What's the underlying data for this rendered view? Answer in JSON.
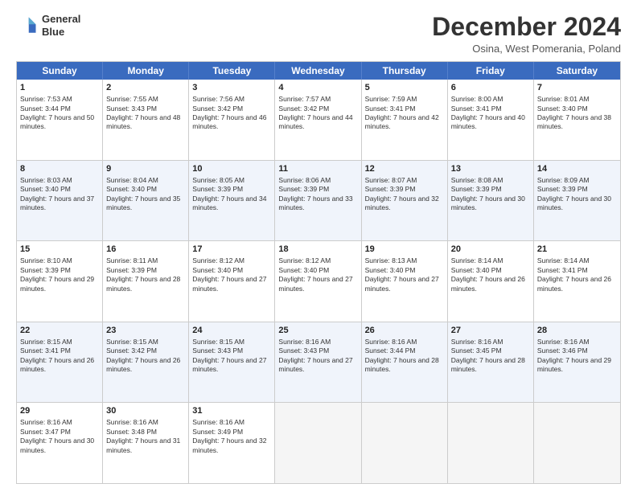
{
  "header": {
    "logo_line1": "General",
    "logo_line2": "Blue",
    "title": "December 2024",
    "subtitle": "Osina, West Pomerania, Poland"
  },
  "weekdays": [
    "Sunday",
    "Monday",
    "Tuesday",
    "Wednesday",
    "Thursday",
    "Friday",
    "Saturday"
  ],
  "rows": [
    [
      {
        "day": "1",
        "sunrise": "Sunrise: 7:53 AM",
        "sunset": "Sunset: 3:44 PM",
        "daylight": "Daylight: 7 hours and 50 minutes."
      },
      {
        "day": "2",
        "sunrise": "Sunrise: 7:55 AM",
        "sunset": "Sunset: 3:43 PM",
        "daylight": "Daylight: 7 hours and 48 minutes."
      },
      {
        "day": "3",
        "sunrise": "Sunrise: 7:56 AM",
        "sunset": "Sunset: 3:42 PM",
        "daylight": "Daylight: 7 hours and 46 minutes."
      },
      {
        "day": "4",
        "sunrise": "Sunrise: 7:57 AM",
        "sunset": "Sunset: 3:42 PM",
        "daylight": "Daylight: 7 hours and 44 minutes."
      },
      {
        "day": "5",
        "sunrise": "Sunrise: 7:59 AM",
        "sunset": "Sunset: 3:41 PM",
        "daylight": "Daylight: 7 hours and 42 minutes."
      },
      {
        "day": "6",
        "sunrise": "Sunrise: 8:00 AM",
        "sunset": "Sunset: 3:41 PM",
        "daylight": "Daylight: 7 hours and 40 minutes."
      },
      {
        "day": "7",
        "sunrise": "Sunrise: 8:01 AM",
        "sunset": "Sunset: 3:40 PM",
        "daylight": "Daylight: 7 hours and 38 minutes."
      }
    ],
    [
      {
        "day": "8",
        "sunrise": "Sunrise: 8:03 AM",
        "sunset": "Sunset: 3:40 PM",
        "daylight": "Daylight: 7 hours and 37 minutes."
      },
      {
        "day": "9",
        "sunrise": "Sunrise: 8:04 AM",
        "sunset": "Sunset: 3:40 PM",
        "daylight": "Daylight: 7 hours and 35 minutes."
      },
      {
        "day": "10",
        "sunrise": "Sunrise: 8:05 AM",
        "sunset": "Sunset: 3:39 PM",
        "daylight": "Daylight: 7 hours and 34 minutes."
      },
      {
        "day": "11",
        "sunrise": "Sunrise: 8:06 AM",
        "sunset": "Sunset: 3:39 PM",
        "daylight": "Daylight: 7 hours and 33 minutes."
      },
      {
        "day": "12",
        "sunrise": "Sunrise: 8:07 AM",
        "sunset": "Sunset: 3:39 PM",
        "daylight": "Daylight: 7 hours and 32 minutes."
      },
      {
        "day": "13",
        "sunrise": "Sunrise: 8:08 AM",
        "sunset": "Sunset: 3:39 PM",
        "daylight": "Daylight: 7 hours and 30 minutes."
      },
      {
        "day": "14",
        "sunrise": "Sunrise: 8:09 AM",
        "sunset": "Sunset: 3:39 PM",
        "daylight": "Daylight: 7 hours and 30 minutes."
      }
    ],
    [
      {
        "day": "15",
        "sunrise": "Sunrise: 8:10 AM",
        "sunset": "Sunset: 3:39 PM",
        "daylight": "Daylight: 7 hours and 29 minutes."
      },
      {
        "day": "16",
        "sunrise": "Sunrise: 8:11 AM",
        "sunset": "Sunset: 3:39 PM",
        "daylight": "Daylight: 7 hours and 28 minutes."
      },
      {
        "day": "17",
        "sunrise": "Sunrise: 8:12 AM",
        "sunset": "Sunset: 3:40 PM",
        "daylight": "Daylight: 7 hours and 27 minutes."
      },
      {
        "day": "18",
        "sunrise": "Sunrise: 8:12 AM",
        "sunset": "Sunset: 3:40 PM",
        "daylight": "Daylight: 7 hours and 27 minutes."
      },
      {
        "day": "19",
        "sunrise": "Sunrise: 8:13 AM",
        "sunset": "Sunset: 3:40 PM",
        "daylight": "Daylight: 7 hours and 27 minutes."
      },
      {
        "day": "20",
        "sunrise": "Sunrise: 8:14 AM",
        "sunset": "Sunset: 3:40 PM",
        "daylight": "Daylight: 7 hours and 26 minutes."
      },
      {
        "day": "21",
        "sunrise": "Sunrise: 8:14 AM",
        "sunset": "Sunset: 3:41 PM",
        "daylight": "Daylight: 7 hours and 26 minutes."
      }
    ],
    [
      {
        "day": "22",
        "sunrise": "Sunrise: 8:15 AM",
        "sunset": "Sunset: 3:41 PM",
        "daylight": "Daylight: 7 hours and 26 minutes."
      },
      {
        "day": "23",
        "sunrise": "Sunrise: 8:15 AM",
        "sunset": "Sunset: 3:42 PM",
        "daylight": "Daylight: 7 hours and 26 minutes."
      },
      {
        "day": "24",
        "sunrise": "Sunrise: 8:15 AM",
        "sunset": "Sunset: 3:43 PM",
        "daylight": "Daylight: 7 hours and 27 minutes."
      },
      {
        "day": "25",
        "sunrise": "Sunrise: 8:16 AM",
        "sunset": "Sunset: 3:43 PM",
        "daylight": "Daylight: 7 hours and 27 minutes."
      },
      {
        "day": "26",
        "sunrise": "Sunrise: 8:16 AM",
        "sunset": "Sunset: 3:44 PM",
        "daylight": "Daylight: 7 hours and 28 minutes."
      },
      {
        "day": "27",
        "sunrise": "Sunrise: 8:16 AM",
        "sunset": "Sunset: 3:45 PM",
        "daylight": "Daylight: 7 hours and 28 minutes."
      },
      {
        "day": "28",
        "sunrise": "Sunrise: 8:16 AM",
        "sunset": "Sunset: 3:46 PM",
        "daylight": "Daylight: 7 hours and 29 minutes."
      }
    ],
    [
      {
        "day": "29",
        "sunrise": "Sunrise: 8:16 AM",
        "sunset": "Sunset: 3:47 PM",
        "daylight": "Daylight: 7 hours and 30 minutes."
      },
      {
        "day": "30",
        "sunrise": "Sunrise: 8:16 AM",
        "sunset": "Sunset: 3:48 PM",
        "daylight": "Daylight: 7 hours and 31 minutes."
      },
      {
        "day": "31",
        "sunrise": "Sunrise: 8:16 AM",
        "sunset": "Sunset: 3:49 PM",
        "daylight": "Daylight: 7 hours and 32 minutes."
      },
      null,
      null,
      null,
      null
    ]
  ]
}
